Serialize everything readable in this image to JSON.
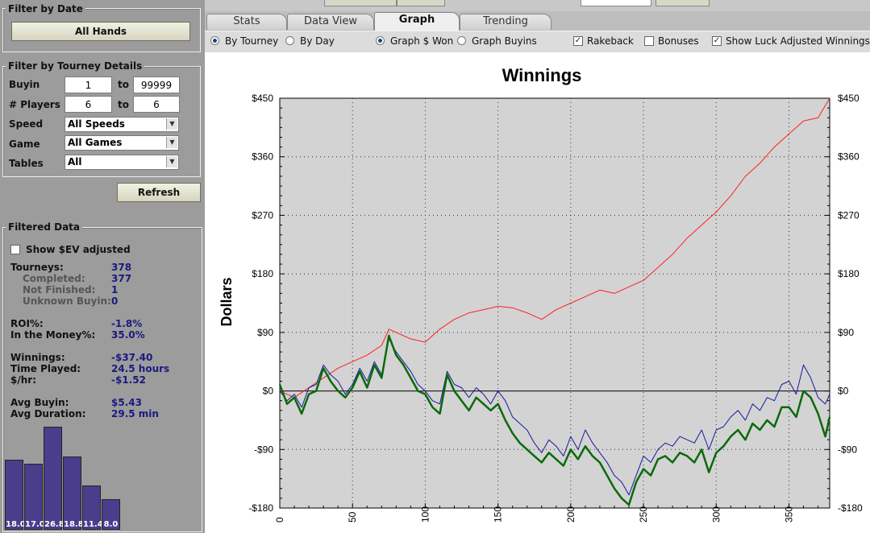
{
  "filter_by_date": {
    "title": "Filter by Date",
    "button": "All Hands"
  },
  "filter_by_tourney": {
    "title": "Filter by Tourney Details",
    "buyin": {
      "label": "Buyin",
      "from": "1",
      "to_label": "to",
      "to": "99999"
    },
    "players": {
      "label": "# Players",
      "from": "6",
      "to_label": "to",
      "to": "6"
    },
    "speed": {
      "label": "Speed",
      "value": "All Speeds"
    },
    "game": {
      "label": "Game",
      "value": "All Games"
    },
    "tables": {
      "label": "Tables",
      "value": "All"
    },
    "refresh": "Refresh"
  },
  "filtered_data": {
    "title": "Filtered Data",
    "show_ev": "Show $EV adjusted",
    "rows": [
      {
        "label": "Tourneys:",
        "value": "378"
      },
      {
        "label": "Completed:",
        "value": "377"
      },
      {
        "label": "Not Finished:",
        "value": "1"
      },
      {
        "label": "Unknown Buyin:",
        "value": "0"
      },
      {
        "label": "ROI%:",
        "value": "-1.8%"
      },
      {
        "label": "In the Money%:",
        "value": "35.0%"
      },
      {
        "label": "Winnings:",
        "value": "-$37.40"
      },
      {
        "label": "Time Played:",
        "value": "24.5 hours"
      },
      {
        "label": "$/hr:",
        "value": "-$1.52"
      },
      {
        "label": "Avg Buyin:",
        "value": "$5.43"
      },
      {
        "label": "Avg Duration:",
        "value": "29.5 min"
      }
    ],
    "histogram": [
      "18.0",
      "17.0",
      "26.8",
      "18.8",
      "11.4",
      "8.0"
    ]
  },
  "tabs": [
    "Stats",
    "Data View",
    "Graph",
    "Trending"
  ],
  "active_tab": "Graph",
  "options": {
    "by_tourney": "By Tourney",
    "by_day": "By Day",
    "graph_won": "Graph $ Won",
    "graph_buyins": "Graph Buyins",
    "rakeback": "Rakeback",
    "bonuses": "Bonuses",
    "luck": "Show Luck Adjusted Winnings"
  },
  "chart_data": {
    "type": "line",
    "title": "Winnings",
    "ylabel": "Dollars",
    "xlabel": "",
    "ylim": [
      -180,
      450
    ],
    "xlim": [
      0,
      378
    ],
    "yticks": [
      -180,
      -90,
      0,
      90,
      180,
      270,
      360,
      450
    ],
    "ytick_labels": [
      "-$180",
      "-$90",
      "$0",
      "$90",
      "$180",
      "$270",
      "$360",
      "$450"
    ],
    "xticks": [
      0,
      50,
      100,
      150,
      200,
      250,
      300,
      350
    ],
    "grid": true,
    "colors": {
      "red": "#ff2020",
      "blue": "#1818a0",
      "green": "#0a6a0a"
    },
    "series": [
      {
        "color": "red",
        "x": [
          0,
          10,
          20,
          30,
          40,
          50,
          60,
          70,
          75,
          80,
          90,
          100,
          110,
          120,
          130,
          140,
          150,
          160,
          170,
          180,
          190,
          200,
          210,
          220,
          230,
          240,
          250,
          260,
          270,
          280,
          290,
          300,
          310,
          320,
          330,
          340,
          350,
          360,
          370,
          378
        ],
        "y": [
          0,
          -10,
          5,
          20,
          35,
          45,
          55,
          70,
          95,
          90,
          80,
          75,
          95,
          110,
          120,
          125,
          130,
          128,
          120,
          110,
          125,
          135,
          145,
          155,
          150,
          160,
          170,
          190,
          210,
          235,
          255,
          275,
          300,
          330,
          350,
          375,
          395,
          415,
          420,
          450
        ]
      },
      {
        "color": "blue",
        "x": [
          0,
          5,
          10,
          15,
          20,
          25,
          30,
          35,
          40,
          45,
          50,
          55,
          60,
          65,
          70,
          75,
          80,
          85,
          90,
          95,
          100,
          105,
          110,
          115,
          120,
          125,
          130,
          135,
          140,
          145,
          150,
          155,
          160,
          165,
          170,
          175,
          180,
          185,
          190,
          195,
          200,
          205,
          210,
          215,
          220,
          225,
          230,
          235,
          240,
          245,
          250,
          255,
          260,
          265,
          270,
          275,
          280,
          285,
          290,
          295,
          300,
          305,
          310,
          315,
          320,
          325,
          330,
          335,
          340,
          345,
          350,
          355,
          360,
          365,
          370,
          375,
          378
        ],
        "y": [
          0,
          -15,
          -5,
          -25,
          5,
          10,
          40,
          25,
          15,
          -5,
          10,
          35,
          15,
          45,
          25,
          80,
          60,
          45,
          30,
          10,
          0,
          -15,
          -20,
          30,
          10,
          5,
          -10,
          5,
          -5,
          -20,
          0,
          -15,
          -40,
          -50,
          -60,
          -80,
          -95,
          -75,
          -85,
          -100,
          -70,
          -90,
          -60,
          -80,
          -95,
          -110,
          -130,
          -140,
          -160,
          -130,
          -100,
          -110,
          -90,
          -80,
          -85,
          -70,
          -75,
          -80,
          -60,
          -90,
          -60,
          -55,
          -40,
          -30,
          -45,
          -20,
          -30,
          -10,
          -15,
          10,
          15,
          -5,
          40,
          20,
          -10,
          -20,
          -5
        ]
      },
      {
        "color": "green",
        "x": [
          0,
          5,
          10,
          15,
          20,
          25,
          30,
          35,
          40,
          45,
          50,
          55,
          60,
          65,
          70,
          75,
          80,
          85,
          90,
          95,
          100,
          105,
          110,
          115,
          120,
          125,
          130,
          135,
          140,
          145,
          150,
          155,
          160,
          165,
          170,
          175,
          180,
          185,
          190,
          195,
          200,
          205,
          210,
          215,
          220,
          225,
          230,
          235,
          240,
          245,
          250,
          255,
          260,
          265,
          270,
          275,
          280,
          285,
          290,
          295,
          300,
          305,
          310,
          315,
          320,
          325,
          330,
          335,
          340,
          345,
          350,
          355,
          360,
          365,
          370,
          375,
          378
        ],
        "y": [
          10,
          -20,
          -10,
          -35,
          -5,
          0,
          35,
          15,
          0,
          -10,
          5,
          30,
          5,
          40,
          20,
          85,
          55,
          40,
          20,
          0,
          -5,
          -25,
          -35,
          25,
          0,
          -15,
          -30,
          -10,
          -20,
          -30,
          -20,
          -45,
          -65,
          -80,
          -90,
          -100,
          -110,
          -95,
          -105,
          -115,
          -90,
          -105,
          -85,
          -100,
          -110,
          -130,
          -150,
          -165,
          -175,
          -140,
          -120,
          -130,
          -105,
          -100,
          -110,
          -95,
          -100,
          -110,
          -90,
          -125,
          -95,
          -85,
          -70,
          -60,
          -75,
          -50,
          -60,
          -45,
          -55,
          -25,
          -25,
          -40,
          0,
          -10,
          -35,
          -70,
          -40
        ]
      }
    ]
  }
}
